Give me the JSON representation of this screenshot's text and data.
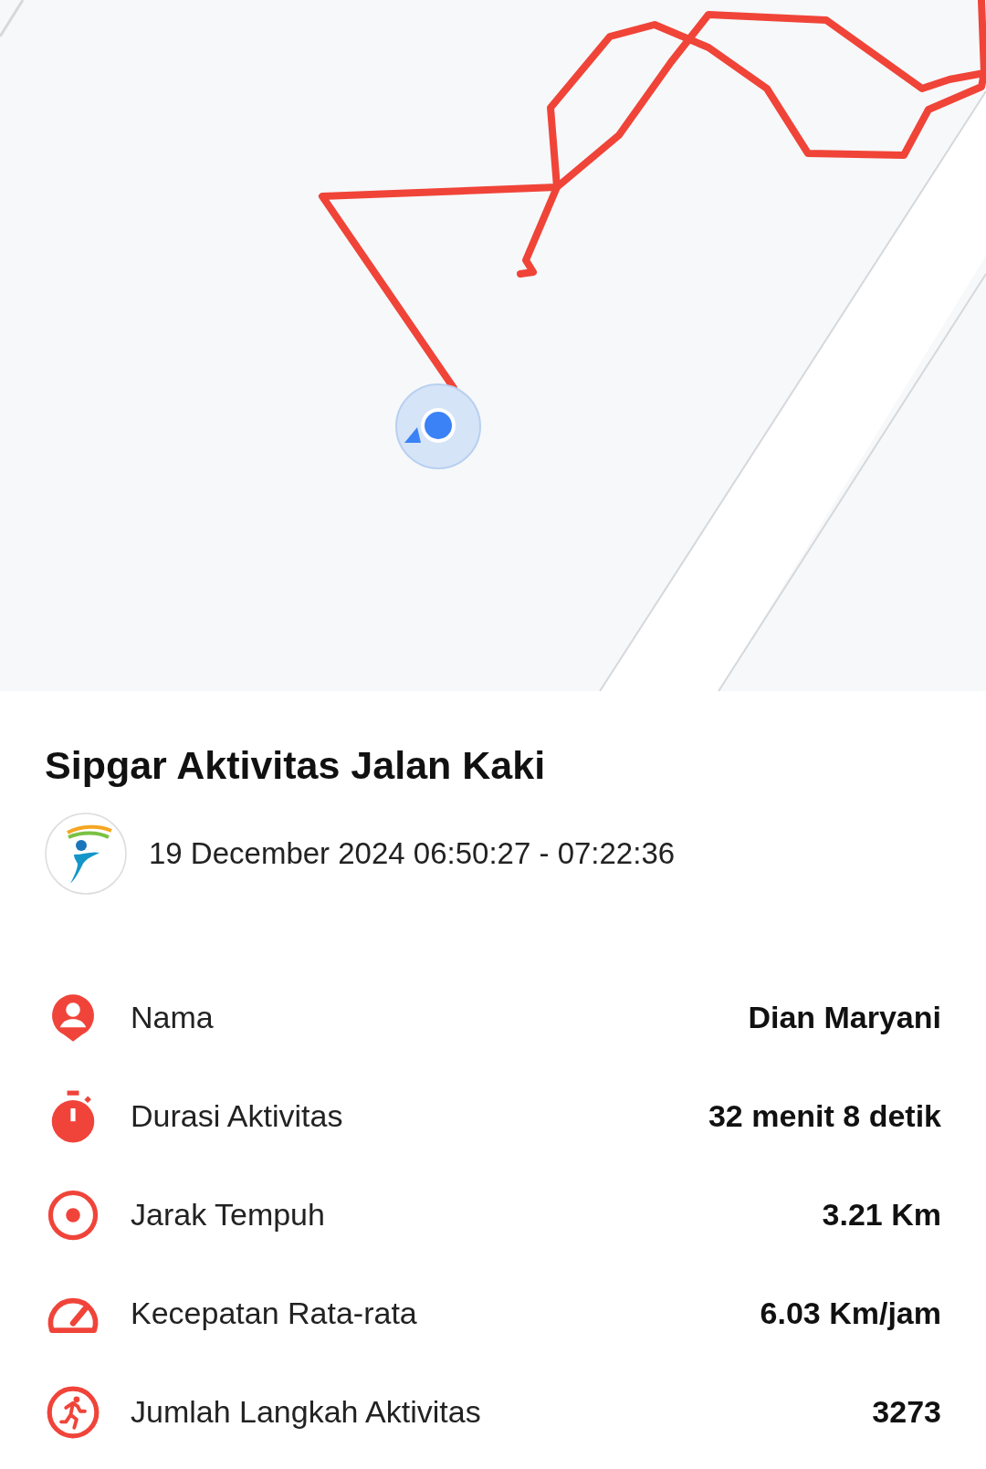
{
  "title": "Sipgar Aktivitas Jalan Kaki",
  "datetime": "19 December 2024 06:50:27 - 07:22:36",
  "stats": [
    {
      "kind": "person",
      "label": "Nama",
      "value": "Dian Maryani"
    },
    {
      "kind": "timer",
      "label": "Durasi Aktivitas",
      "value": "32 menit 8 detik"
    },
    {
      "kind": "target",
      "label": "Jarak Tempuh",
      "value": "3.21 Km"
    },
    {
      "kind": "speed",
      "label": "Kecepatan Rata-rata",
      "value": "6.03 Km/jam"
    },
    {
      "kind": "steps",
      "label": "Jumlah Langkah Aktivitas",
      "value": "3273"
    }
  ]
}
